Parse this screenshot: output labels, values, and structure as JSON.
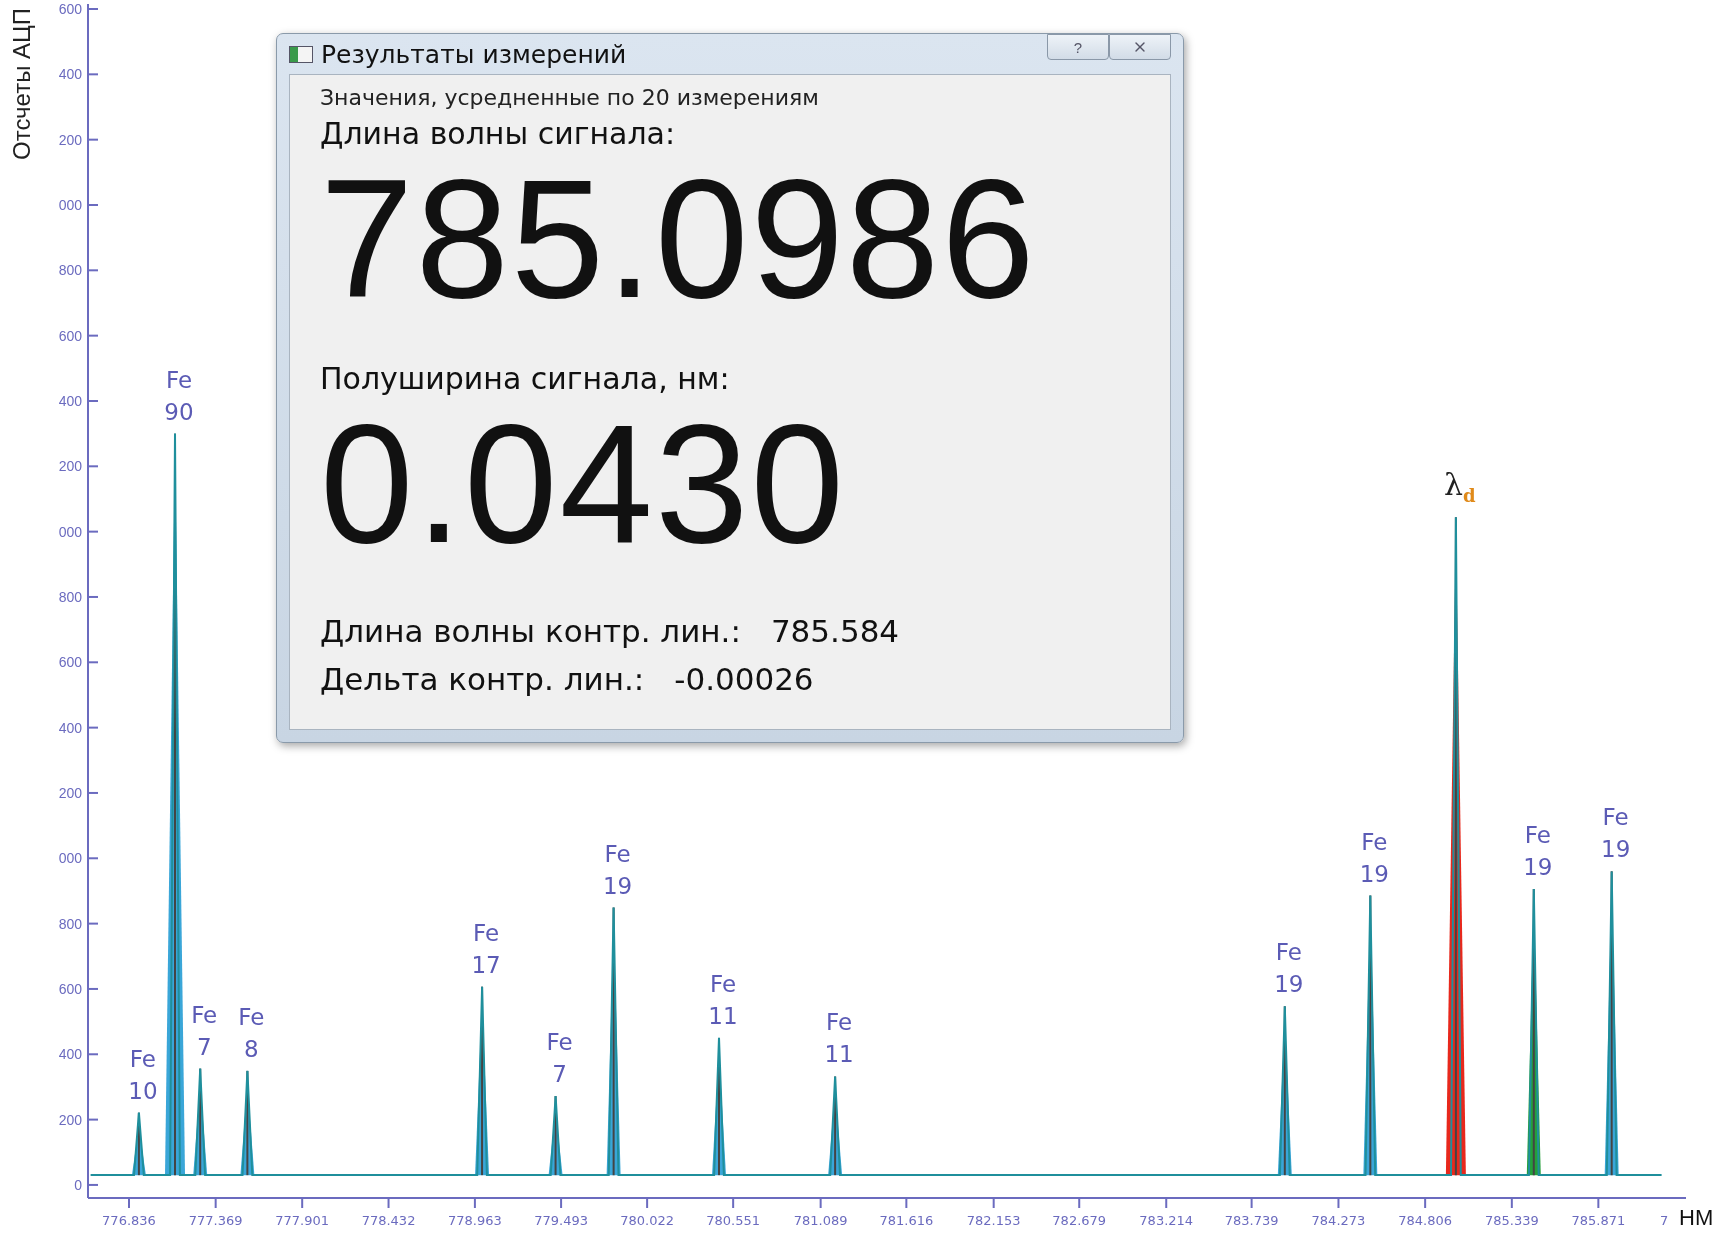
{
  "chart": {
    "cut_y_tick_labels": [
      "600",
      "400",
      "200",
      "000",
      "800",
      "600",
      "400",
      "200",
      "000",
      "800",
      "600",
      "400",
      "200",
      "000"
    ],
    "x_cut_label": "7",
    "peaks": [
      {
        "color": "#3aa6d8"
      },
      {
        "color": "#3aa6d8"
      },
      {
        "color": "#3aa6d8"
      },
      {
        "color": "#3aa6d8"
      },
      {
        "color": "#3aa6d8"
      },
      {
        "color": "#3aa6d8"
      },
      {
        "color": "#3aa6d8"
      },
      {
        "color": "#3aa6d8"
      },
      {
        "color": "#3aa6d8"
      },
      {
        "color": "#3aa6d8"
      },
      {
        "color": "#3aa6d8"
      },
      {
        "color": "#e8281c",
        "kind": "symbol"
      },
      {
        "color": "#25a03a"
      },
      {
        "color": "#3aa6d8"
      }
    ],
    "chart_data": {
      "type": "line",
      "ylabel": "Отсчеты АЦП",
      "xlabel": "НМ",
      "x": [
        776.6,
        776.867,
        776.897,
        776.927,
        777.089,
        777.119,
        777.149,
        777.244,
        777.274,
        777.304,
        777.534,
        777.564,
        777.594,
        778.977,
        779.007,
        779.037,
        779.429,
        779.459,
        779.489,
        779.786,
        779.816,
        779.846,
        780.434,
        780.464,
        780.494,
        781.148,
        781.178,
        781.208,
        783.913,
        783.943,
        783.973,
        784.439,
        784.469,
        784.499,
        784.965,
        784.995,
        785.025,
        785.444,
        785.474,
        785.504,
        785.923,
        785.953,
        785.983,
        786.26
      ],
      "values": [
        30,
        30,
        221,
        30,
        30,
        2300,
        30,
        30,
        356,
        30,
        30,
        349,
        30,
        30,
        607,
        30,
        30,
        272,
        30,
        30,
        849,
        30,
        30,
        450,
        30,
        30,
        332,
        30,
        30,
        547,
        30,
        30,
        886,
        30,
        30,
        2044,
        30,
        30,
        906,
        30,
        30,
        960,
        30,
        30
      ],
      "xlim": [
        776.584,
        786.41
      ],
      "ylim": [
        -40,
        3600
      ],
      "xticks": [
        {
          "value": 776.836,
          "label": "776.836"
        },
        {
          "value": 777.369,
          "label": "777.369"
        },
        {
          "value": 777.901,
          "label": "777.901"
        },
        {
          "value": 778.432,
          "label": "778.432"
        },
        {
          "value": 778.963,
          "label": "778.963"
        },
        {
          "value": 779.493,
          "label": "779.493"
        },
        {
          "value": 780.022,
          "label": "780.022"
        },
        {
          "value": 780.551,
          "label": "780.551"
        },
        {
          "value": 781.089,
          "label": "781.089"
        },
        {
          "value": 781.616,
          "label": "781.616"
        },
        {
          "value": 782.153,
          "label": "782.153"
        },
        {
          "value": 782.679,
          "label": "782.679"
        },
        {
          "value": 783.214,
          "label": "783.214"
        },
        {
          "value": 783.739,
          "label": "783.739"
        },
        {
          "value": 784.273,
          "label": "784.273"
        },
        {
          "value": 784.806,
          "label": "784.806"
        },
        {
          "value": 785.339,
          "label": "785.339"
        },
        {
          "value": 785.871,
          "label": "785.871"
        }
      ],
      "yticks": [
        0,
        200,
        400,
        600,
        800
      ],
      "annotations": [
        {
          "x": 776.897,
          "y": 221,
          "text": "Fe 10"
        },
        {
          "x": 777.119,
          "y": 2300,
          "text": "Fe 90"
        },
        {
          "x": 777.274,
          "y": 356,
          "text": "Fe 7"
        },
        {
          "x": 777.564,
          "y": 349,
          "text": "Fe 8"
        },
        {
          "x": 779.007,
          "y": 607,
          "text": "Fe 17"
        },
        {
          "x": 779.459,
          "y": 272,
          "text": "Fe 7"
        },
        {
          "x": 779.816,
          "y": 849,
          "text": "Fe 19"
        },
        {
          "x": 780.464,
          "y": 450,
          "text": "Fe 11"
        },
        {
          "x": 781.178,
          "y": 332,
          "text": "Fe 11"
        },
        {
          "x": 783.943,
          "y": 547,
          "text": "Fe 19"
        },
        {
          "x": 784.469,
          "y": 886,
          "text": "Fe 19"
        },
        {
          "x": 784.995,
          "y": 2044,
          "text": "λ$_{d}$"
        },
        {
          "x": 785.474,
          "y": 906,
          "text": "Fe 19"
        },
        {
          "x": 785.953,
          "y": 960,
          "text": "Fe 19"
        }
      ]
    }
  },
  "dialog": {
    "title": "Результаты измерений",
    "help_button": "?",
    "subtitle": "Значения, усредненные по 20 измерениям",
    "wavelength_label": "Длина волны сигнала:",
    "wavelength_value": "785.0986",
    "halfwidth_label": "Полуширина сигнала, нм:",
    "halfwidth_value": "0.0430",
    "ref_rows": [
      {
        "label": "Длина волны контр. лин.:",
        "value": "785.584"
      },
      {
        "label": "Дельта контр. лин.:",
        "value": "-0.00026"
      }
    ]
  }
}
